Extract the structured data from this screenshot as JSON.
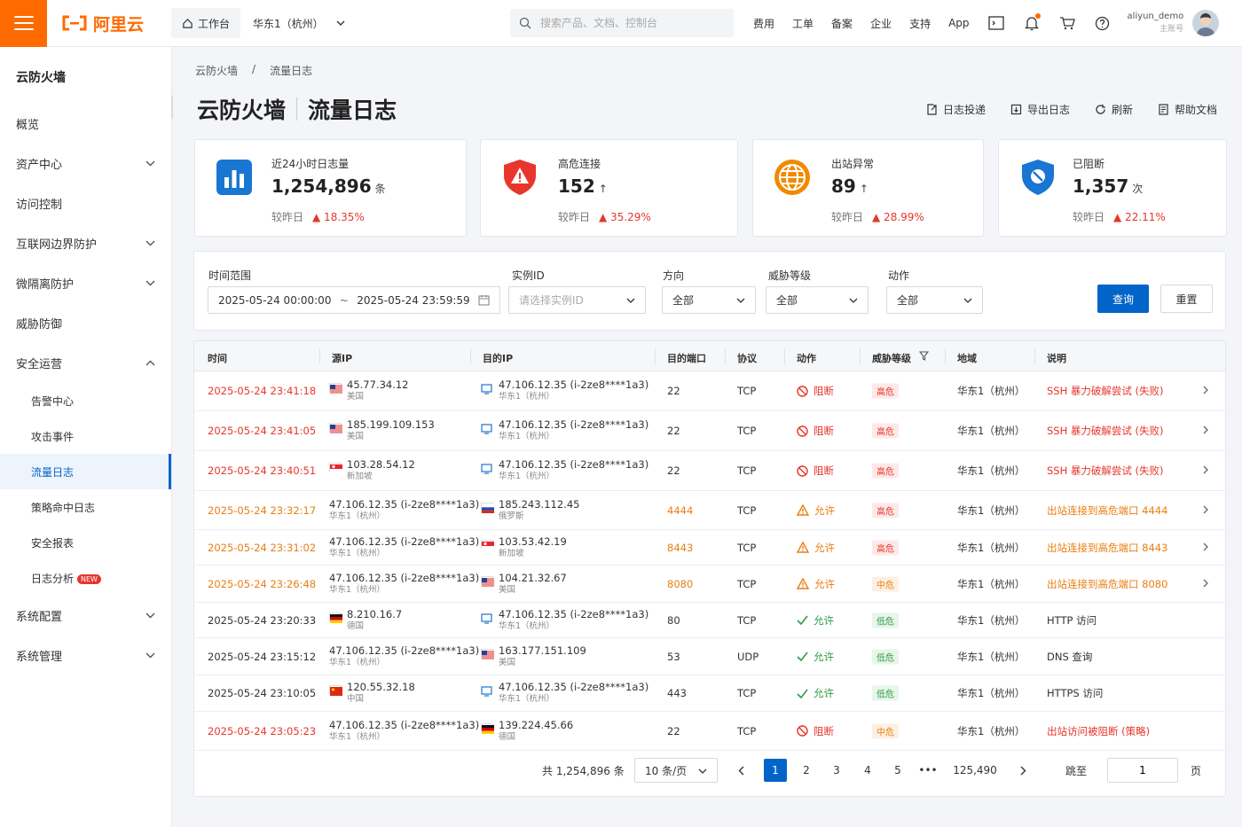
{
  "top": {
    "logo": "阿里云",
    "workspace": "工作台",
    "region": "华东1（杭州）",
    "search_placeholder": "搜索产品、文档、控制台",
    "nav": [
      "费用",
      "工单",
      "备案",
      "企业",
      "支持",
      "App"
    ],
    "username": "aliyun_demo",
    "role": "主账号"
  },
  "sidebar": {
    "title": "云防火墙",
    "items": [
      {
        "label": "概览",
        "expand": false,
        "sub": false
      },
      {
        "label": "资产中心",
        "expand": true,
        "sub": false
      },
      {
        "label": "访问控制",
        "expand": false,
        "sub": false
      },
      {
        "label": "互联网边界防护",
        "expand": true,
        "sub": false
      },
      {
        "label": "微隔离防护",
        "expand": true,
        "sub": false
      },
      {
        "label": "威胁防御",
        "expand": false,
        "sub": false
      },
      {
        "label": "安全运营",
        "expand": true,
        "open": true,
        "sub": false
      },
      {
        "label": "告警中心",
        "sub": true
      },
      {
        "label": "攻击事件",
        "sub": true
      },
      {
        "label": "流量日志",
        "sub": true,
        "active": true
      },
      {
        "label": "策略命中日志",
        "sub": true
      },
      {
        "label": "安全报表",
        "sub": true
      },
      {
        "label": "日志分析",
        "sub": true,
        "badge": "NEW"
      },
      {
        "label": "系统配置",
        "expand": true,
        "sub": false
      },
      {
        "label": "系统管理",
        "expand": true,
        "sub": false
      }
    ]
  },
  "breadcrumb": [
    "云防火墙",
    "/",
    "流量日志"
  ],
  "page": {
    "title_a": "云防火墙",
    "title_b": "流量日志",
    "actions": [
      "日志投递",
      "导出日志",
      "刷新",
      "帮助文档"
    ]
  },
  "cards": [
    {
      "label": "近24小时日志量",
      "value": "1,254,896",
      "unit": "条",
      "cmp": "较昨日",
      "delta": "▲ 18.35%",
      "up": false
    },
    {
      "label": "高危连接",
      "value": "152",
      "unit": "↑",
      "cmp": "较昨日",
      "delta": "▲ 35.29%"
    },
    {
      "label": "出站异常",
      "value": "89",
      "unit": "↑",
      "cmp": "较昨日",
      "delta": "▲ 28.99%"
    },
    {
      "label": "已阻断",
      "value": "1,357",
      "unit": "次",
      "cmp": "较昨日",
      "delta": "▲ 22.11%"
    }
  ],
  "filter": {
    "time_label": "时间范围",
    "time_start": "2025-05-24 00:00:00",
    "time_sep": "~",
    "time_end": "2025-05-24 23:59:59",
    "instance_label": "实例ID",
    "instance_placeholder": "请选择实例ID",
    "dir_label": "方向",
    "dir_value": "全部",
    "threat_label": "威胁等级",
    "threat_value": "全部",
    "action_label": "动作",
    "action_value": "全部",
    "query": "查询",
    "reset": "重置"
  },
  "table": {
    "headers": [
      "时间",
      "源IP",
      "目的IP",
      "目的端口",
      "协议",
      "动作",
      "威胁等级",
      "地域",
      "说明"
    ],
    "rows": [
      {
        "time": "2025-05-24 23:41:18",
        "tc": "red",
        "src": "45.77.34.12",
        "src_sub": "美国",
        "src_flag": "us",
        "dst": "47.106.12.35 (i-2ze8****1a3)",
        "dst_sub": "华东1（杭州）",
        "dst_host": true,
        "port": "22",
        "pc": "",
        "proto": "TCP",
        "action": "阻断",
        "akind": "block",
        "level": "高危",
        "lk": "hi",
        "region": "华东1（杭州）",
        "desc": "SSH 暴力破解尝试 (失败)",
        "dc": "red",
        "arrow": true
      },
      {
        "time": "2025-05-24 23:41:05",
        "tc": "red",
        "src": "185.199.109.153",
        "src_sub": "美国",
        "src_flag": "us",
        "dst": "47.106.12.35 (i-2ze8****1a3)",
        "dst_sub": "华东1（杭州）",
        "dst_host": true,
        "port": "22",
        "pc": "",
        "proto": "TCP",
        "action": "阻断",
        "akind": "block",
        "level": "高危",
        "lk": "hi",
        "region": "华东1（杭州）",
        "desc": "SSH 暴力破解尝试 (失败)",
        "dc": "red",
        "arrow": true
      },
      {
        "time": "2025-05-24 23:40:51",
        "tc": "red",
        "src": "103.28.54.12",
        "src_sub": "新加坡",
        "src_flag": "sg",
        "dst": "47.106.12.35 (i-2ze8****1a3)",
        "dst_sub": "华东1（杭州）",
        "dst_host": true,
        "port": "22",
        "pc": "",
        "proto": "TCP",
        "action": "阻断",
        "akind": "block",
        "level": "高危",
        "lk": "hi",
        "region": "华东1（杭州）",
        "desc": "SSH 暴力破解尝试 (失败)",
        "dc": "red",
        "arrow": true
      },
      {
        "time": "2025-05-24 23:32:17",
        "tc": "org",
        "src": "47.106.12.35 (i-2ze8****1a3)",
        "src_sub": "华东1（杭州）",
        "src_flag": "",
        "dst": "185.243.112.45",
        "dst_sub": "俄罗斯",
        "dst_flag": "ru",
        "port": "4444",
        "pc": "org",
        "proto": "TCP",
        "action": "允许",
        "akind": "warn",
        "level": "高危",
        "lk": "hi",
        "region": "华东1（杭州）",
        "desc": "出站连接到高危端口 4444",
        "dc": "org",
        "arrow": true
      },
      {
        "time": "2025-05-24 23:31:02",
        "tc": "org",
        "src": "47.106.12.35 (i-2ze8****1a3)",
        "src_sub": "华东1（杭州）",
        "src_flag": "",
        "dst": "103.53.42.19",
        "dst_sub": "新加坡",
        "dst_flag": "sg",
        "port": "8443",
        "pc": "org",
        "proto": "TCP",
        "action": "允许",
        "akind": "warn",
        "level": "高危",
        "lk": "hi",
        "region": "华东1（杭州）",
        "desc": "出站连接到高危端口 8443",
        "dc": "org",
        "arrow": true
      },
      {
        "time": "2025-05-24 23:26:48",
        "tc": "org",
        "src": "47.106.12.35 (i-2ze8****1a3)",
        "src_sub": "华东1（杭州）",
        "src_flag": "",
        "dst": "104.21.32.67",
        "dst_sub": "美国",
        "dst_flag": "us",
        "port": "8080",
        "pc": "org",
        "proto": "TCP",
        "action": "允许",
        "akind": "warn",
        "level": "中危",
        "lk": "mid",
        "region": "华东1（杭州）",
        "desc": "出站连接到高危端口 8080",
        "dc": "org",
        "arrow": true
      },
      {
        "time": "2025-05-24 23:20:33",
        "tc": "",
        "src": "8.210.16.7",
        "src_sub": "德国",
        "src_flag": "de",
        "dst": "47.106.12.35 (i-2ze8****1a3)",
        "dst_sub": "华东1（杭州）",
        "dst_host": true,
        "port": "80",
        "pc": "",
        "proto": "TCP",
        "action": "允许",
        "akind": "ok",
        "level": "低危",
        "lk": "lo",
        "region": "华东1（杭州）",
        "desc": "HTTP 访问",
        "dc": "",
        "arrow": false
      },
      {
        "time": "2025-05-24 23:15:12",
        "tc": "",
        "src": "47.106.12.35 (i-2ze8****1a3)",
        "src_sub": "华东1（杭州）",
        "src_flag": "",
        "dst": "163.177.151.109",
        "dst_sub": "美国",
        "dst_flag": "us",
        "port": "53",
        "pc": "",
        "proto": "UDP",
        "action": "允许",
        "akind": "ok",
        "level": "低危",
        "lk": "lo",
        "region": "华东1（杭州）",
        "desc": "DNS 查询",
        "dc": "",
        "arrow": false
      },
      {
        "time": "2025-05-24 23:10:05",
        "tc": "",
        "src": "120.55.32.18",
        "src_sub": "中国",
        "src_flag": "cn",
        "dst": "47.106.12.35 (i-2ze8****1a3)",
        "dst_sub": "华东1（杭州）",
        "dst_host": true,
        "port": "443",
        "pc": "",
        "proto": "TCP",
        "action": "允许",
        "akind": "ok",
        "level": "低危",
        "lk": "lo",
        "region": "华东1（杭州）",
        "desc": "HTTPS 访问",
        "dc": "",
        "arrow": false
      },
      {
        "time": "2025-05-24 23:05:23",
        "tc": "red",
        "src": "47.106.12.35 (i-2ze8****1a3)",
        "src_sub": "华东1（杭州）",
        "src_flag": "",
        "dst": "139.224.45.66",
        "dst_sub": "德国",
        "dst_flag": "de",
        "port": "22",
        "pc": "",
        "proto": "TCP",
        "action": "阻断",
        "akind": "block",
        "level": "中危",
        "lk": "mid",
        "region": "华东1（杭州）",
        "desc": "出站访问被阻断 (策略)",
        "dc": "red",
        "arrow": false
      }
    ]
  },
  "pager": {
    "total": "共 1,254,896 条",
    "size": "10 条/页",
    "pages": [
      "1",
      "2",
      "3",
      "4",
      "5"
    ],
    "ellipsis": "•••",
    "last": "125,490",
    "goto": "跳至",
    "goto_value": "1",
    "page_unit": "页"
  },
  "colors": {
    "accent": "#0064c8",
    "brand": "#ff6a00",
    "danger": "#e8362c",
    "warn": "#e97e12",
    "ok": "#2e9c45"
  }
}
